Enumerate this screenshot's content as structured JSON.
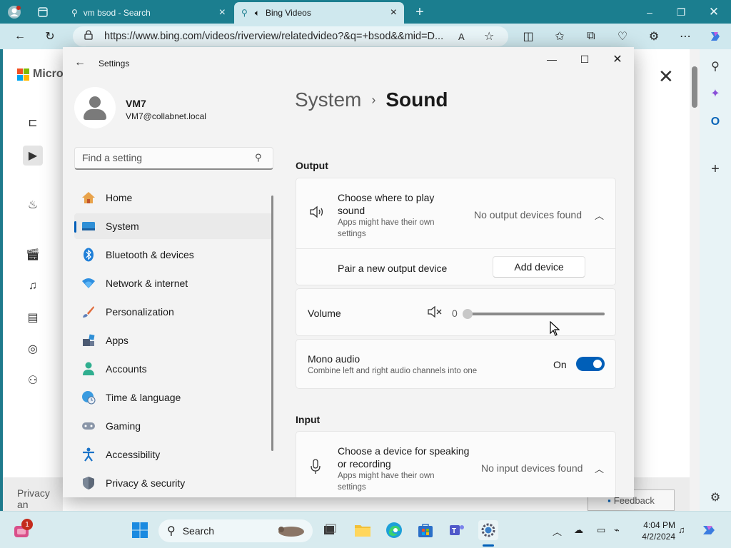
{
  "browser": {
    "tabs": [
      {
        "title": "vm bsod - Search",
        "icon": "search-icon"
      },
      {
        "title": "Bing Videos",
        "icon": "speaker-icon"
      }
    ],
    "url": "https://www.bing.com/videos/riverview/relatedvideo?&q=+bsod&&mid=D..."
  },
  "page": {
    "logo_text": "Micros",
    "privacy_text": "Privacy an",
    "feedback_label": "Feedback"
  },
  "settings": {
    "window_title": "Settings",
    "user": {
      "name": "VM7",
      "email": "VM7@collabnet.local"
    },
    "search_placeholder": "Find a setting",
    "nav": [
      {
        "label": "Home",
        "icon": "home-icon"
      },
      {
        "label": "System",
        "icon": "system-icon"
      },
      {
        "label": "Bluetooth & devices",
        "icon": "bluetooth-icon"
      },
      {
        "label": "Network & internet",
        "icon": "wifi-icon"
      },
      {
        "label": "Personalization",
        "icon": "brush-icon"
      },
      {
        "label": "Apps",
        "icon": "apps-icon"
      },
      {
        "label": "Accounts",
        "icon": "person-icon"
      },
      {
        "label": "Time & language",
        "icon": "globe-clock-icon"
      },
      {
        "label": "Gaming",
        "icon": "gamepad-icon"
      },
      {
        "label": "Accessibility",
        "icon": "accessibility-icon"
      },
      {
        "label": "Privacy & security",
        "icon": "shield-icon"
      }
    ],
    "breadcrumb": {
      "parent": "System",
      "separator": "›",
      "current": "Sound"
    },
    "output": {
      "heading": "Output",
      "device_title": "Choose where to play sound",
      "device_subtitle": "Apps might have their own settings",
      "device_value": "No output devices found",
      "pair_label": "Pair a new output device",
      "add_button": "Add device"
    },
    "volume": {
      "label": "Volume",
      "value": "0",
      "level": 0
    },
    "mono": {
      "title": "Mono audio",
      "subtitle": "Combine left and right audio channels into one",
      "state": "On"
    },
    "input": {
      "heading": "Input",
      "device_title": "Choose a device for speaking or recording",
      "device_subtitle": "Apps might have their own settings",
      "device_value": "No input devices found"
    }
  },
  "taskbar": {
    "search_label": "Search",
    "notification_count": "1",
    "time": "4:04 PM",
    "date": "4/2/2024"
  },
  "colors": {
    "accent": "#005fb8",
    "browser_frame": "#1b7e8f",
    "taskbar": "#d8ebef"
  }
}
